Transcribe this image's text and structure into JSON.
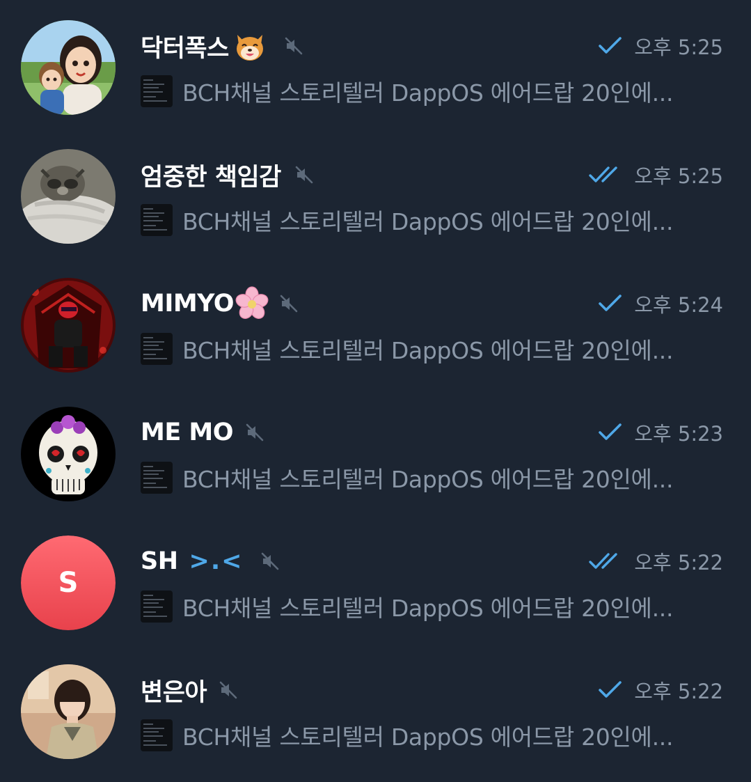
{
  "chats": [
    {
      "name": "닥터폭스",
      "emoji": "shiba-dog-emoji",
      "muted": true,
      "status": "sent",
      "time": "오후 5:25",
      "preview": "BCH채널 스토리텔러 DappOS 에어드랍 20인에...",
      "avatar": "cartoon-mother-child-avatar"
    },
    {
      "name": "엄중한 책임감",
      "muted": true,
      "status": "read",
      "time": "오후 5:25",
      "preview": "BCH채널 스토리텔러 DappOS 에어드랍 20인에...",
      "avatar": "raccoon-photo-avatar"
    },
    {
      "name": "MIMYO",
      "emoji": "cherry-blossom-emoji",
      "muted": true,
      "status": "sent",
      "time": "오후 5:24",
      "preview": "BCH채널 스토리텔러 DappOS 에어드랍 20인에...",
      "avatar": "red-throne-avatar"
    },
    {
      "name": "ME MO",
      "muted": true,
      "status": "sent",
      "time": "오후 5:23",
      "preview": "BCH채널 스토리텔러 DappOS 에어드랍 20인에...",
      "avatar": "sugar-skull-avatar"
    },
    {
      "name": "SH",
      "name_suffix": ">.<",
      "muted": true,
      "status": "read",
      "time": "오후 5:22",
      "preview": "BCH채널 스토리텔러 DappOS 에어드랍 20인에...",
      "avatar_letter": "S",
      "avatar_color": "#f0505a"
    },
    {
      "name": "변은아",
      "muted": true,
      "status": "sent",
      "time": "오후 5:22",
      "preview": "BCH채널 스토리텔러 DappOS 에어드랍 20인에...",
      "avatar": "woman-photo-avatar"
    }
  ],
  "colors": {
    "background": "#1c2532",
    "name": "#ffffff",
    "secondary_text": "#8b98a8",
    "check": "#4fa8e8",
    "mute_icon": "#5d6a7a"
  }
}
